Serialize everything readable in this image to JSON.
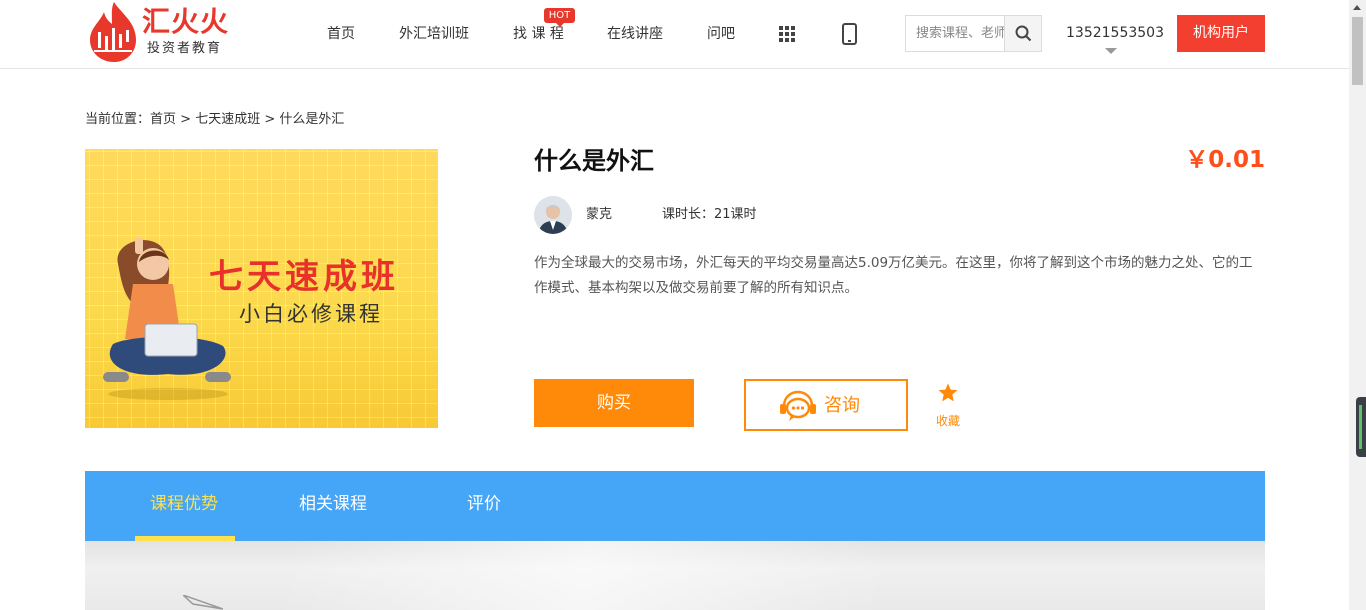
{
  "header": {
    "logo_text": "汇火火",
    "logo_sub": "投资者教育",
    "nav": [
      "首页",
      "外汇培训班",
      "找 课 程",
      "在线讲座",
      "问吧"
    ],
    "hot_badge": "HOT",
    "search_placeholder": "搜索课程、老师",
    "phone": "13521553503",
    "org_button": "机构用户",
    "icons": {
      "apps": "grid-icon",
      "mobile": "mobile-phone-icon",
      "search": "search-icon",
      "dropdown": "caret-down-icon"
    }
  },
  "breadcrumb": {
    "prefix": "当前位置：",
    "home": "首页",
    "sep1": " > ",
    "category": "七天速成班",
    "sep2": " > ",
    "current": "什么是外汇"
  },
  "banner": {
    "title": "七天速成班",
    "subtitle": "小白必修课程"
  },
  "course": {
    "title": "什么是外汇",
    "price": "￥0.01",
    "teacher": "蒙克",
    "duration": "课时长：21课时",
    "description": "作为全球最大的交易市场，外汇每天的平均交易量高达5.09万亿美元。在这里，你将了解到这个市场的魅力之处、它的工作模式、基本构架以及做交易前要了解的所有知识点。",
    "buy_label": "购买",
    "consult_label": "咨询",
    "favorite_label": "收藏"
  },
  "tabs": [
    "课程优势",
    "相关课程",
    "评价"
  ],
  "colors": {
    "brand_red": "#e8382b",
    "org_button": "#f33f2f",
    "accent_orange": "#ff8a0a",
    "price": "#ff4e19",
    "tab_bar": "#45a5f6",
    "tab_active": "#ffe14d"
  }
}
